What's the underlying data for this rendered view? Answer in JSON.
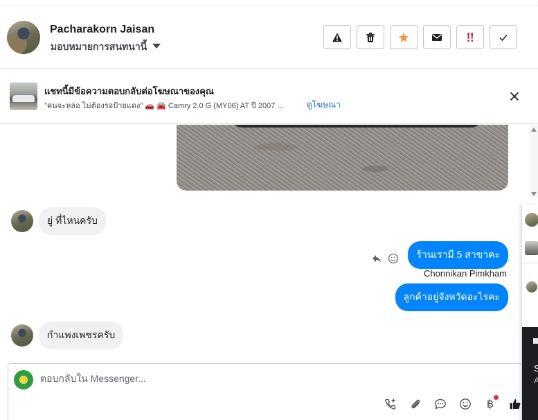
{
  "header": {
    "name": "Pacharakorn Jaisan",
    "assign_label": "มอบหมายการสนทนานี้"
  },
  "actions": [
    {
      "name": "report-spam-button",
      "icon": "warning-icon"
    },
    {
      "name": "delete-button",
      "icon": "trash-icon"
    },
    {
      "name": "star-button",
      "icon": "star-icon"
    },
    {
      "name": "mark-unread-button",
      "icon": "envelope-icon"
    },
    {
      "name": "follow-up-button",
      "icon": "exclamation-icon"
    },
    {
      "name": "mark-done-button",
      "icon": "check-icon"
    }
  ],
  "ad": {
    "title": "แชทนี้มีข้อความตอบกลับต่อโฆษณาของคุณ",
    "description": "\"คนจะหล่อ ไม่ต้องรอป้ายแดง\" 🚗 🚘 Camry 2.0 G (MY06) AT ปี 2007 ...",
    "link": "ดูโฆษณา"
  },
  "messages": {
    "in1": "ยู่ ที่ไหนครับ",
    "out1": "ร้านเรามี 5 สาขาคะ",
    "sender": "Chonnikan Pimkham",
    "out2": "ลูกค้าอยู่จังหวัดอะไรคะ",
    "in2": "กำแพงเพชรครับ"
  },
  "composer": {
    "placeholder": "ตอบกลับใน Messenger...",
    "currency_symbol": "฿"
  },
  "side_panel": {
    "text1": "S",
    "text2": "A"
  },
  "colors": {
    "accent": "#0084ff",
    "star": "#f7923b",
    "follow_up": "#e41e3f",
    "link": "#216fdb"
  }
}
